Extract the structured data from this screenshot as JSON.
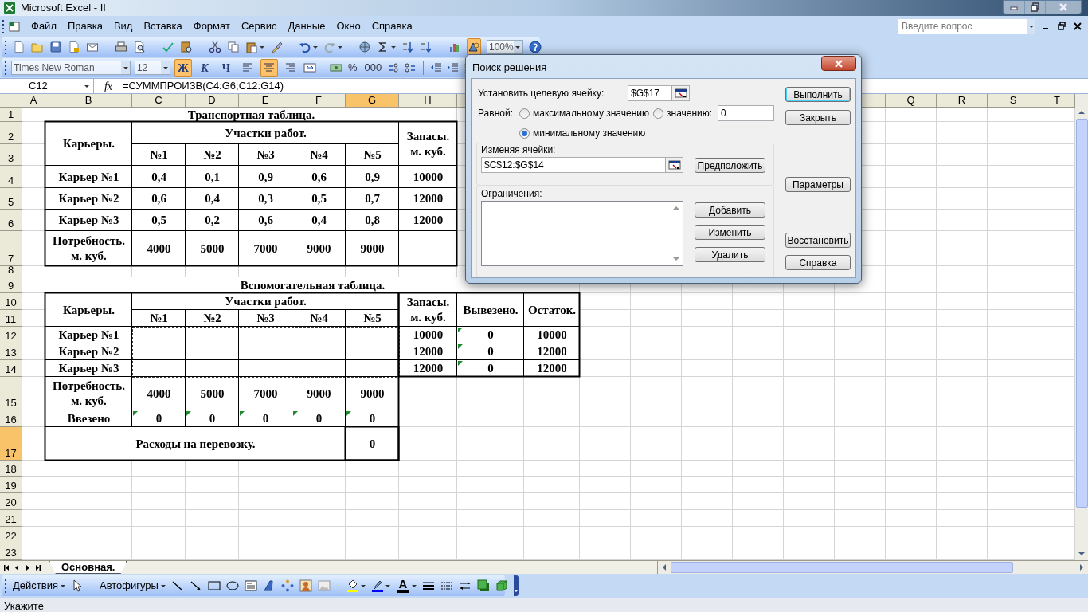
{
  "window": {
    "title": "Microsoft Excel - II"
  },
  "menu": [
    "Файл",
    "Правка",
    "Вид",
    "Вставка",
    "Формат",
    "Сервис",
    "Данные",
    "Окно",
    "Справка"
  ],
  "help_search": {
    "placeholder": "Введите вопрос"
  },
  "standard_toolbar": {
    "drawing_selected": true,
    "zoom": "100%"
  },
  "formatting_toolbar": {
    "font": "Times New Roman",
    "size": "12",
    "style_buttons": [
      {
        "label": "Ж",
        "selected": true
      },
      {
        "label": "К",
        "selected": false
      },
      {
        "label": "Ч",
        "selected": false
      }
    ],
    "align_buttons": [
      {
        "selected": false
      },
      {
        "selected": true
      },
      {
        "selected": false
      }
    ],
    "number_buttons": [
      "%",
      "000"
    ]
  },
  "formula_bar": {
    "name_box": "C12",
    "function_label": "fx",
    "formula": "=СУММПРОИЗВ(C4:G6;C12:G14)"
  },
  "sheet": {
    "column_headers": [
      {
        "label": "A",
        "selected": false
      },
      {
        "label": "B",
        "selected": false
      },
      {
        "label": "C",
        "selected": false
      },
      {
        "label": "D",
        "selected": false
      },
      {
        "label": "E",
        "selected": false
      },
      {
        "label": "F",
        "selected": false
      },
      {
        "label": "G",
        "selected": true
      },
      {
        "label": "H",
        "selected": false
      },
      {
        "label": "Q",
        "selected": false
      },
      {
        "label": "R",
        "selected": false
      },
      {
        "label": "S",
        "selected": false
      },
      {
        "label": "T",
        "selected": false
      }
    ],
    "row_headers": [
      {
        "label": "1",
        "selected": false
      },
      {
        "label": "2",
        "selected": false
      },
      {
        "label": "3",
        "selected": false
      },
      {
        "label": "4",
        "selected": false
      },
      {
        "label": "5",
        "selected": false
      },
      {
        "label": "6",
        "selected": false
      },
      {
        "label": "7",
        "selected": false
      },
      {
        "label": "8",
        "selected": false
      },
      {
        "label": "9",
        "selected": false
      },
      {
        "label": "10",
        "selected": false
      },
      {
        "label": "11",
        "selected": false
      },
      {
        "label": "12",
        "selected": false
      },
      {
        "label": "13",
        "selected": false
      },
      {
        "label": "14",
        "selected": false
      },
      {
        "label": "15",
        "selected": false
      },
      {
        "label": "16",
        "selected": false
      },
      {
        "label": "17",
        "selected": true
      },
      {
        "label": "18",
        "selected": false
      },
      {
        "label": "19",
        "selected": false
      },
      {
        "label": "20",
        "selected": false
      },
      {
        "label": "21",
        "selected": false
      },
      {
        "label": "22",
        "selected": false
      },
      {
        "label": "23",
        "selected": false
      }
    ],
    "copy_marquee": true,
    "cells": [
      {
        "text": "Транспортная таблица."
      },
      {
        "text": "Карьеры."
      },
      {
        "text": "Участки работ."
      },
      {
        "text": "№1"
      },
      {
        "text": "№2"
      },
      {
        "text": "№3"
      },
      {
        "text": "№4"
      },
      {
        "text": "№5"
      },
      {
        "text": "Запасы. м. куб."
      },
      {
        "text": "Карьер №1"
      },
      {
        "text": "0,4"
      },
      {
        "text": "0,1"
      },
      {
        "text": "0,9"
      },
      {
        "text": "0,6"
      },
      {
        "text": "0,9"
      },
      {
        "text": "10000"
      },
      {
        "text": "Карьер №2"
      },
      {
        "text": "0,6"
      },
      {
        "text": "0,4"
      },
      {
        "text": "0,3"
      },
      {
        "text": "0,5"
      },
      {
        "text": "0,7"
      },
      {
        "text": "12000"
      },
      {
        "text": "Карьер №3"
      },
      {
        "text": "0,5"
      },
      {
        "text": "0,2"
      },
      {
        "text": "0,6"
      },
      {
        "text": "0,4"
      },
      {
        "text": "0,8"
      },
      {
        "text": "12000"
      },
      {
        "text": "Потребность. м. куб."
      },
      {
        "text": "4000"
      },
      {
        "text": "5000"
      },
      {
        "text": "7000"
      },
      {
        "text": "9000"
      },
      {
        "text": "9000"
      },
      {
        "text": "Вспомогательная таблица."
      },
      {
        "text": "Карьеры."
      },
      {
        "text": "Участки работ."
      },
      {
        "text": "№1"
      },
      {
        "text": "№2"
      },
      {
        "text": "№3"
      },
      {
        "text": "№4"
      },
      {
        "text": "№5"
      },
      {
        "text": "Запасы. м. куб."
      },
      {
        "text": "Вывезено."
      },
      {
        "text": "Остаток."
      },
      {
        "text": "Карьер №1"
      },
      {
        "text": "10000"
      },
      {
        "text": "0",
        "error_mark": true
      },
      {
        "text": "10000"
      },
      {
        "text": "Карьер №2"
      },
      {
        "text": "12000"
      },
      {
        "text": "0",
        "error_mark": true
      },
      {
        "text": "12000"
      },
      {
        "text": "Карьер №3"
      },
      {
        "text": "12000"
      },
      {
        "text": "0",
        "error_mark": true
      },
      {
        "text": "12000"
      },
      {
        "text": "Потребность. м. куб."
      },
      {
        "text": "4000"
      },
      {
        "text": "5000"
      },
      {
        "text": "7000"
      },
      {
        "text": "9000"
      },
      {
        "text": "9000"
      },
      {
        "text": "Ввезено"
      },
      {
        "text": "0",
        "error_mark": true
      },
      {
        "text": "0",
        "error_mark": true
      },
      {
        "text": "0",
        "error_mark": true
      },
      {
        "text": "0",
        "error_mark": true
      },
      {
        "text": "0",
        "error_mark": true
      },
      {
        "text": "Расходы на перевозку."
      },
      {
        "text": "0"
      }
    ]
  },
  "sheet_tabs": [
    {
      "label": "Основная.",
      "selected": true
    }
  ],
  "solver_dialog": {
    "title": "Поиск решения",
    "target_label": "Установить целевую ячейку:",
    "target_value": "$G$17",
    "equal_label": "Равной:",
    "options": [
      {
        "label": "максимальному значению",
        "selected": false
      },
      {
        "label": "значению:",
        "selected": false
      },
      {
        "label": "минимальному значению",
        "selected": true
      }
    ],
    "value_field": "0",
    "changing_label": "Изменяя ячейки:",
    "changing_value": "$C$12:$G$14",
    "guess_button": "Предположить",
    "constraints_label": "Ограничения:",
    "constraint_buttons": [
      "Добавить",
      "Изменить",
      "Удалить"
    ],
    "side_buttons": [
      "Выполнить",
      "Закрыть",
      "Параметры",
      "Восстановить",
      "Справка"
    ]
  },
  "drawing_toolbar": {
    "actions": "Действия",
    "autoshapes": "Автофигуры",
    "font_color": "A"
  },
  "status_bar": "Укажите"
}
